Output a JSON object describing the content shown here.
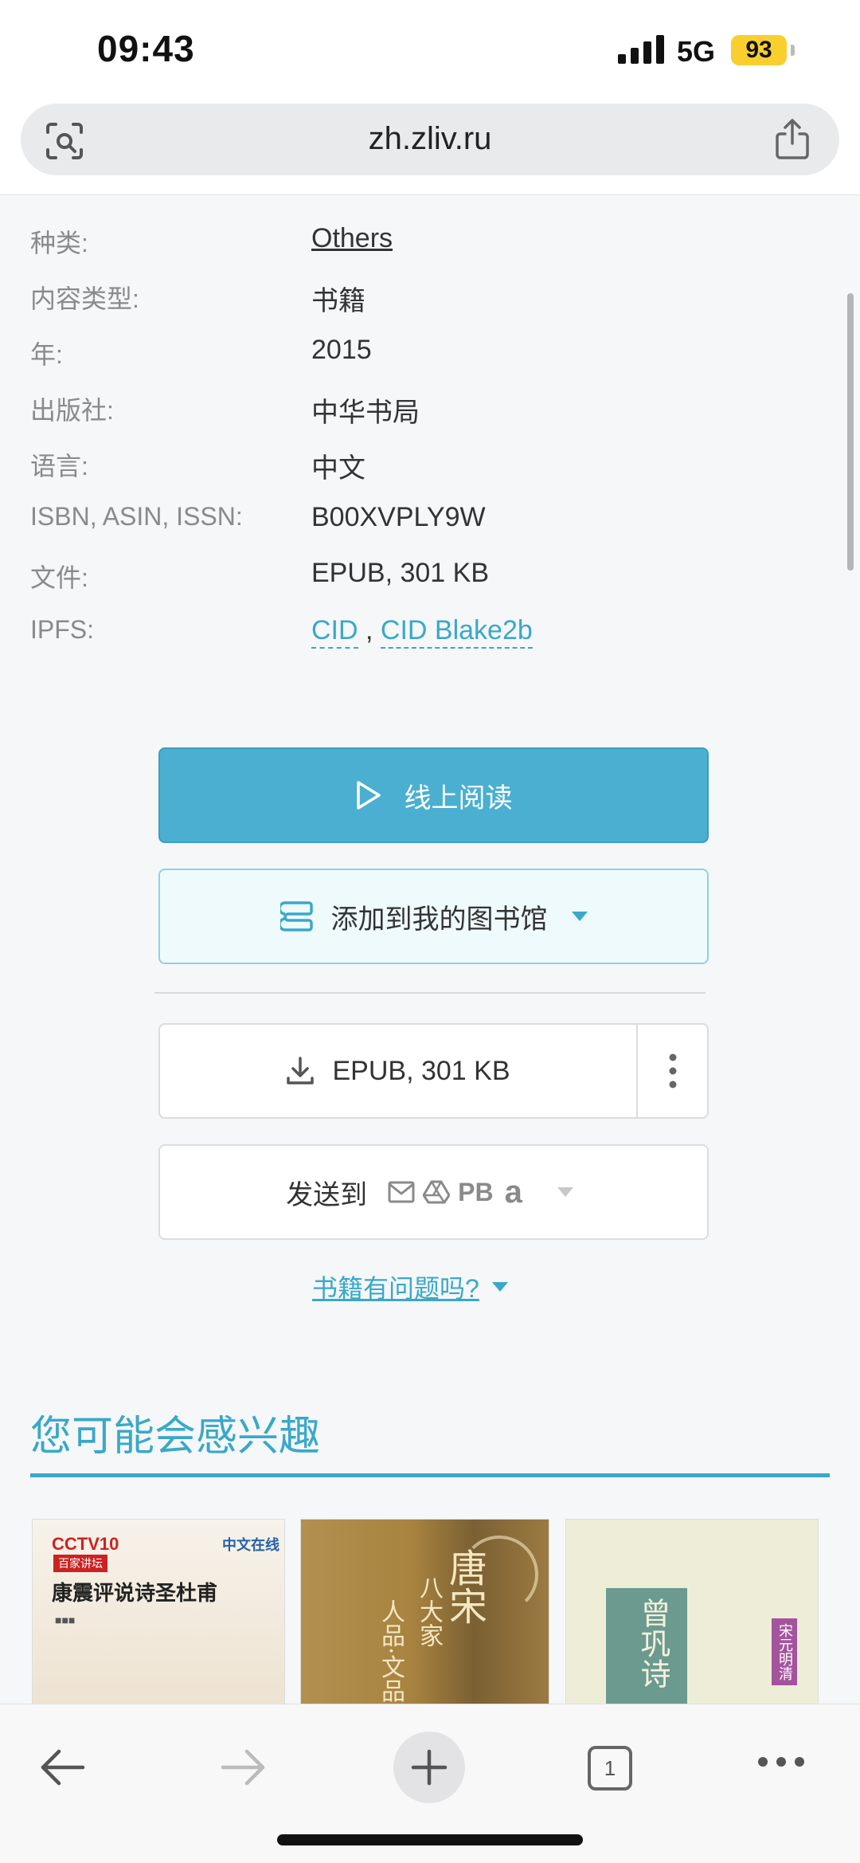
{
  "status": {
    "time": "09:43",
    "network": "5G",
    "battery": "93"
  },
  "browser": {
    "url": "zh.zliv.ru"
  },
  "details": [
    {
      "label": "种类:",
      "value": "Others"
    },
    {
      "label": "内容类型:",
      "value": "书籍"
    },
    {
      "label": "年:",
      "value": "2015"
    },
    {
      "label": "出版社:",
      "value": "中华书局"
    },
    {
      "label": "语言:",
      "value": "中文"
    },
    {
      "label": "ISBN, ASIN, ISSN:",
      "value": "B00XVPLY9W"
    },
    {
      "label": "文件:",
      "value": "EPUB, 301 KB"
    },
    {
      "label": "IPFS:",
      "links": [
        "CID",
        "CID Blake2b"
      ],
      "separator": " , "
    }
  ],
  "actions": {
    "read_label": "线上阅读",
    "library_label": "添加到我的图书馆",
    "download_label": "EPUB, 301 KB",
    "send_label": "发送到",
    "send_pb": "PB",
    "send_amazon": "a",
    "problem_label": "书籍有问题吗?"
  },
  "recommendations": {
    "title": "您可能会感兴趣",
    "covers": [
      {
        "brand": "CCTV10",
        "brand2": "百家讲坛",
        "publisher": "中文在线",
        "title": "康震评说诗圣杜甫"
      },
      {
        "title": "唐宋",
        "subtitle": "八大家",
        "line2": "人品·文品"
      },
      {
        "title": "曾巩诗",
        "tag": "宋元明清"
      }
    ]
  },
  "toolbar": {
    "tab_count": "1"
  },
  "colors": {
    "accent": "#4aafd0",
    "link": "#3aa8c8",
    "battery": "#f8cf2d"
  }
}
